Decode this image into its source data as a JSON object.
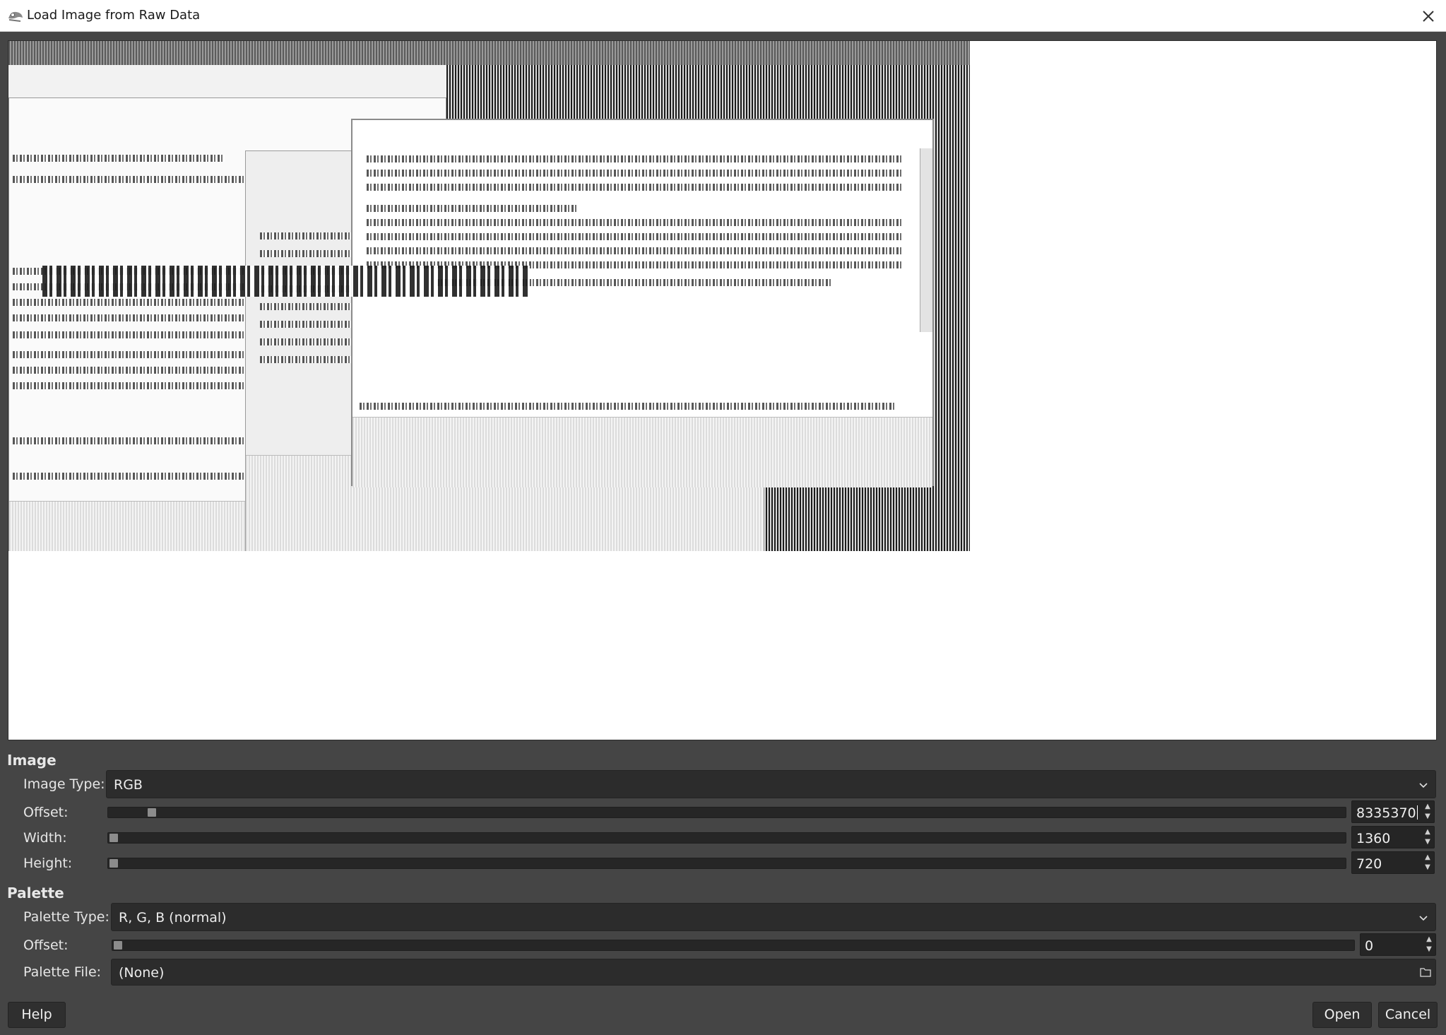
{
  "window": {
    "title": "Load Image from Raw Data"
  },
  "image_section": {
    "title": "Image",
    "image_type_label": "Image Type:",
    "image_type_value": "RGB",
    "offset_label": "Offset:",
    "offset_value": "8335370",
    "offset_fraction": 0.028,
    "width_label": "Width:",
    "width_value": "1360",
    "width_fraction": 0.0,
    "height_label": "Height:",
    "height_value": "720",
    "height_fraction": 0.0
  },
  "palette_section": {
    "title": "Palette",
    "palette_type_label": "Palette Type:",
    "palette_type_value": "R, G, B (normal)",
    "offset_label": "Offset:",
    "offset_value": "0",
    "offset_fraction": 0.0,
    "palette_file_label": "Palette File:",
    "palette_file_value": "(None)"
  },
  "buttons": {
    "help": "Help",
    "open": "Open",
    "cancel": "Cancel"
  },
  "icons": {
    "app": "gimp-icon",
    "close": "close-icon",
    "dropdown": "chevron-down-icon",
    "folder": "folder-icon"
  },
  "colors": {
    "dialog_bg": "#454545",
    "field_bg": "#2c2c2c",
    "title_bar": "#ffffff"
  }
}
